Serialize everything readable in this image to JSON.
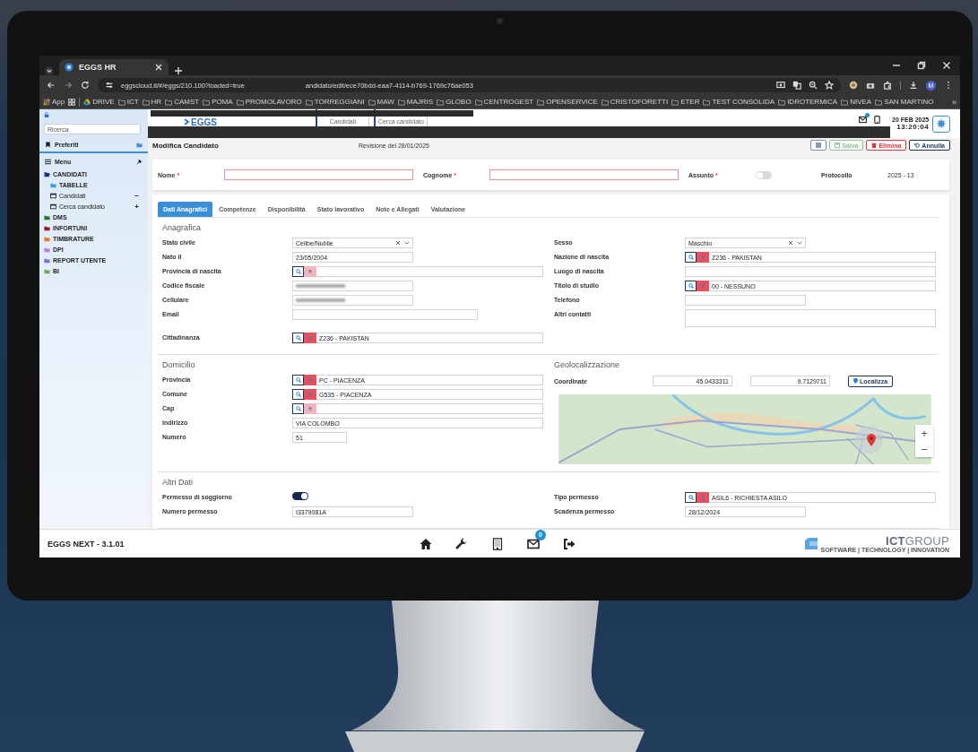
{
  "browser": {
    "tab_title": "EGGS HR",
    "url": "eggscloud.it/#/eggs/210.100?loaded=true",
    "url_overlay": "andidato/edit/ece70bdd-eaa7-4114-b769-1769c76ae053",
    "profile_initial": "M",
    "bookmarks": [
      {
        "kind": "apps",
        "label": "App"
      },
      {
        "kind": "groups"
      },
      {
        "kind": "drive",
        "label": "DRIVE"
      },
      {
        "kind": "folder",
        "label": "ICT"
      },
      {
        "kind": "folder",
        "label": "HR"
      },
      {
        "kind": "folder",
        "label": "CAMST"
      },
      {
        "kind": "folder",
        "label": "POMA"
      },
      {
        "kind": "folder",
        "label": "PROMOLAVORO"
      },
      {
        "kind": "folder",
        "label": "TORREGGIANI"
      },
      {
        "kind": "folder",
        "label": "MAW"
      },
      {
        "kind": "folder",
        "label": "MAJRIS"
      },
      {
        "kind": "folder",
        "label": "GLOBO"
      },
      {
        "kind": "folder",
        "label": "CENTROGEST"
      },
      {
        "kind": "folder",
        "label": "OPENSERVICE"
      },
      {
        "kind": "folder",
        "label": "CRISTOFORETTI"
      },
      {
        "kind": "folder",
        "label": "ETER"
      },
      {
        "kind": "folder",
        "label": "TEST CONSOLIDA"
      },
      {
        "kind": "folder",
        "label": "IDROTERMICA"
      },
      {
        "kind": "folder",
        "label": "NIVEA"
      },
      {
        "kind": "folder",
        "label": "SAN MARTINO"
      }
    ],
    "more": "»"
  },
  "header": {
    "logo": "EGGS",
    "shortcuts": [
      "Candidati",
      "Cerca candidato"
    ],
    "date": "20 FEB 2025",
    "time": "13:20:04"
  },
  "sidebar": {
    "search_placeholder": "Ricerca",
    "favorites": "Preferiti",
    "menu_title": "Menu",
    "menu": [
      {
        "label": "CANDIDATI",
        "color": "#1e2f8a",
        "children": [
          {
            "kind": "folder",
            "label": "TABELLE",
            "color": "#3d9be0"
          },
          {
            "kind": "window",
            "label": "Candidati",
            "action": "−"
          },
          {
            "kind": "window",
            "label": "Cerca candidato",
            "action": "+"
          }
        ]
      },
      {
        "label": "DMS",
        "color": "#1e7d22"
      },
      {
        "label": "INFORTUNI",
        "color": "#a0141e"
      },
      {
        "label": "TIMBRATURE",
        "color": "#e8781e"
      },
      {
        "label": "DPI",
        "color": "#c27ad6"
      },
      {
        "label": "REPORT UTENTE",
        "color": "#7b6fd6"
      },
      {
        "label": "BI",
        "color": "#6fae5c"
      }
    ]
  },
  "page": {
    "title": "Modifica Candidato",
    "revision": "Revisione del 28/01/2025",
    "actions": [
      {
        "kind": "menu",
        "disabled": false
      },
      {
        "kind": "save",
        "label": "Salva",
        "disabled": true
      },
      {
        "kind": "delete",
        "label": "Elimina",
        "disabled": false
      },
      {
        "kind": "cancel",
        "label": "Annulla",
        "disabled": false
      }
    ]
  },
  "summary": {
    "fields": [
      {
        "kind": "text",
        "label": "Nome",
        "required": "*",
        "invalid": true
      },
      {
        "kind": "text",
        "label": "Cognome",
        "required": "*",
        "invalid": true
      },
      {
        "kind": "toggle",
        "label": "Assunto",
        "required": "*",
        "on": false
      },
      {
        "kind": "readonly",
        "label": "Protocollo",
        "value": "2025 - 13"
      }
    ]
  },
  "tabs": [
    {
      "label": "Dati Anagrafici",
      "selected": true
    },
    {
      "label": "Competenze",
      "selected": false
    },
    {
      "label": "Disponibilità",
      "selected": false
    },
    {
      "label": "Stato lavorativo",
      "selected": false
    },
    {
      "label": "Note e Allegati",
      "selected": false
    },
    {
      "label": "Valutazione",
      "selected": false
    }
  ],
  "groups": [
    {
      "left": {
        "title": "Anagrafica",
        "fields": [
          {
            "kind": "select",
            "label": "Stato civile",
            "value": "Celibe/Nubile"
          },
          {
            "kind": "date",
            "label": "Nato il",
            "value": "23/05/2004"
          },
          {
            "kind": "lookup",
            "label": "Provincia di nascita"
          },
          {
            "kind": "blurred",
            "label": "Codice fiscale"
          },
          {
            "kind": "blurred",
            "label": "Cellulare"
          },
          {
            "kind": "email",
            "label": "Email"
          },
          {
            "kind": "lookup",
            "label": "Cittadinanza",
            "value": "Z236 - PAKISTAN"
          }
        ]
      },
      "right": {
        "kind": "fields",
        "fields": [
          {
            "kind": "select",
            "label": "Sesso",
            "value": "Maschio"
          },
          {
            "kind": "lookup",
            "label": "Nazione di nascita",
            "value": "Z236 - PAKISTAN"
          },
          {
            "kind": "longtext",
            "label": "Luogo di nascita"
          },
          {
            "kind": "lookup",
            "label": "Titolo di studio",
            "value": "00 - NESSUNO"
          },
          {
            "kind": "date",
            "label": "Telefono"
          },
          {
            "kind": "textarea",
            "label": "Altri contatti"
          }
        ]
      }
    },
    {
      "left": {
        "title": "Domicilio",
        "fields": [
          {
            "kind": "lookup",
            "label": "Provincia",
            "value": "PC - PIACENZA"
          },
          {
            "kind": "lookup",
            "label": "Comune",
            "value": "G535 - PIACENZA"
          },
          {
            "kind": "lookup",
            "label": "Cap"
          },
          {
            "kind": "longtext",
            "label": "Indirizzo",
            "value": "VIA COLOMBO"
          },
          {
            "kind": "number",
            "label": "Numero",
            "value": "51"
          }
        ]
      },
      "right": {
        "kind": "geo",
        "title": "Geolocalizzazione",
        "label": "Coordinate",
        "latitude": "45.0433311",
        "longitude": "9.7129711",
        "locate": "Localizza",
        "zoom_in": "+",
        "zoom_out": "−"
      }
    },
    {
      "left": {
        "title": "Altri Dati",
        "fields": [
          {
            "kind": "toggle",
            "label": "Permesso di soggiorno",
            "on": true
          },
          {
            "kind": "date",
            "label": "Numero permesso",
            "value": "I3379081A"
          }
        ]
      },
      "right": {
        "kind": "fields",
        "fields": [
          {
            "kind": "lookup",
            "label": "Tipo permesso",
            "value": "ASIL6 - RICHIESTA ASILO"
          },
          {
            "kind": "date",
            "label": "Scadenza permesso",
            "value": "28/12/2024"
          }
        ]
      }
    }
  ],
  "footer": {
    "version": "EGGS NEXT - 3.1.01",
    "mail_badge": "0",
    "brand_bold": "ICT",
    "brand_light": "GROUP",
    "brand_tagline": "SOFTWARE | TECHNOLOGY | INNOVATION"
  }
}
